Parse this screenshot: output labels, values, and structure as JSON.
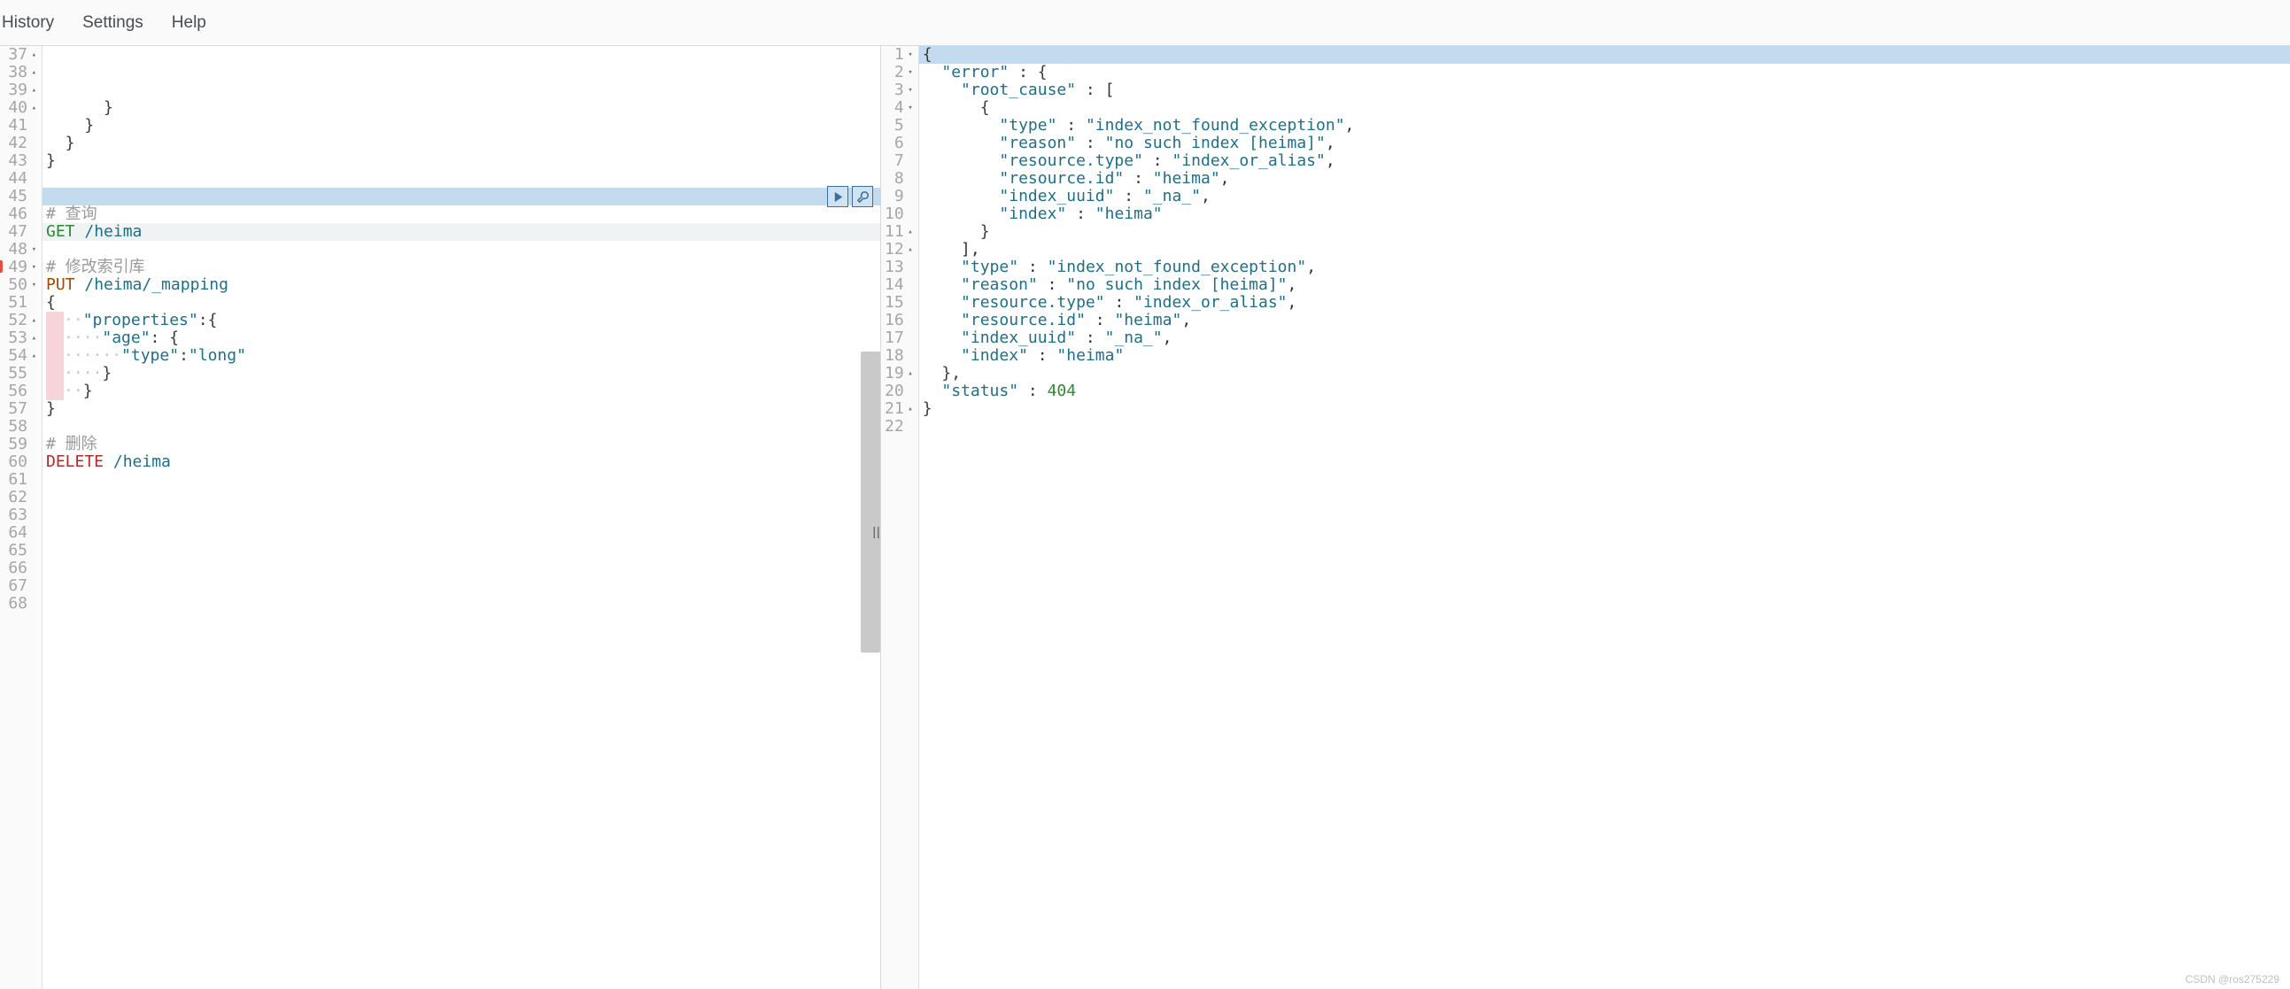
{
  "menubar": {
    "history": "History",
    "settings": "Settings",
    "help": "Help"
  },
  "watermark": "CSDN @ros275229",
  "left_editor": {
    "first_line_number": 37,
    "selected_line_number": 42,
    "error_line_number": 49,
    "lines": [
      {
        "n": 37,
        "fold": "up",
        "type": "code",
        "text": "      }"
      },
      {
        "n": 38,
        "fold": "up",
        "type": "code",
        "text": "    }"
      },
      {
        "n": 39,
        "fold": "up",
        "type": "code",
        "text": "  }"
      },
      {
        "n": 40,
        "fold": "up",
        "type": "code",
        "text": "}"
      },
      {
        "n": 41,
        "type": "blank"
      },
      {
        "n": 42,
        "type": "selected_blank"
      },
      {
        "n": 43,
        "type": "comment",
        "text": "# 查询"
      },
      {
        "n": 44,
        "type": "request",
        "method": "GET",
        "path": "/heima",
        "method_cls": "tk-method-get"
      },
      {
        "n": 45,
        "type": "blank"
      },
      {
        "n": 46,
        "type": "comment",
        "text": "# 修改索引库"
      },
      {
        "n": 47,
        "type": "request",
        "method": "PUT",
        "path": "/heima/_mapping",
        "method_cls": "tk-method-put"
      },
      {
        "n": 48,
        "fold": "down",
        "type": "code",
        "text": "{"
      },
      {
        "n": 49,
        "fold": "down",
        "type": "errcode",
        "indent": 1,
        "text_before": "\"properties\"",
        "text_after": ":{"
      },
      {
        "n": 50,
        "fold": "down",
        "type": "errcode",
        "indent": 2,
        "text_before": "\"age\"",
        "text_after": ": {"
      },
      {
        "n": 51,
        "type": "errcode",
        "indent": 3,
        "kv_key": "\"type\"",
        "kv_val": "\"long\""
      },
      {
        "n": 52,
        "fold": "up",
        "type": "errcode",
        "indent": 2,
        "plain": "}"
      },
      {
        "n": 53,
        "fold": "up",
        "type": "errcode",
        "indent": 1,
        "plain": "}"
      },
      {
        "n": 54,
        "fold": "up",
        "type": "code",
        "text": "}"
      },
      {
        "n": 55,
        "type": "blank"
      },
      {
        "n": 56,
        "type": "comment",
        "text": "# 删除"
      },
      {
        "n": 57,
        "type": "request",
        "method": "DELETE",
        "path": "/heima",
        "method_cls": "tk-method-del"
      },
      {
        "n": 58,
        "type": "blank"
      },
      {
        "n": 59,
        "type": "blank"
      },
      {
        "n": 60,
        "type": "blank"
      },
      {
        "n": 61,
        "type": "blank"
      },
      {
        "n": 62,
        "type": "blank"
      },
      {
        "n": 63,
        "type": "blank"
      },
      {
        "n": 64,
        "type": "blank"
      },
      {
        "n": 65,
        "type": "blank"
      },
      {
        "n": 66,
        "type": "blank"
      },
      {
        "n": 67,
        "type": "blank"
      },
      {
        "n": 68,
        "type": "blank"
      }
    ]
  },
  "right_viewer": {
    "lines": [
      {
        "n": 1,
        "fold": "down",
        "tokens": [
          {
            "t": "{",
            "c": "tk-brace"
          }
        ]
      },
      {
        "n": 2,
        "fold": "down",
        "tokens": [
          {
            "t": "  "
          },
          {
            "t": "\"error\"",
            "c": "tk-key"
          },
          {
            "t": " : "
          },
          {
            "t": "{",
            "c": "tk-brace"
          }
        ]
      },
      {
        "n": 3,
        "fold": "down",
        "tokens": [
          {
            "t": "    "
          },
          {
            "t": "\"root_cause\"",
            "c": "tk-key"
          },
          {
            "t": " : ["
          }
        ]
      },
      {
        "n": 4,
        "fold": "down",
        "tokens": [
          {
            "t": "      "
          },
          {
            "t": "{",
            "c": "tk-brace"
          }
        ]
      },
      {
        "n": 5,
        "tokens": [
          {
            "t": "        "
          },
          {
            "t": "\"type\"",
            "c": "tk-key"
          },
          {
            "t": " : "
          },
          {
            "t": "\"index_not_found_exception\"",
            "c": "tk-str"
          },
          {
            "t": ","
          }
        ]
      },
      {
        "n": 6,
        "tokens": [
          {
            "t": "        "
          },
          {
            "t": "\"reason\"",
            "c": "tk-key"
          },
          {
            "t": " : "
          },
          {
            "t": "\"no such index [heima]\"",
            "c": "tk-str"
          },
          {
            "t": ","
          }
        ]
      },
      {
        "n": 7,
        "tokens": [
          {
            "t": "        "
          },
          {
            "t": "\"resource.type\"",
            "c": "tk-key"
          },
          {
            "t": " : "
          },
          {
            "t": "\"index_or_alias\"",
            "c": "tk-str"
          },
          {
            "t": ","
          }
        ]
      },
      {
        "n": 8,
        "tokens": [
          {
            "t": "        "
          },
          {
            "t": "\"resource.id\"",
            "c": "tk-key"
          },
          {
            "t": " : "
          },
          {
            "t": "\"heima\"",
            "c": "tk-str"
          },
          {
            "t": ","
          }
        ]
      },
      {
        "n": 9,
        "tokens": [
          {
            "t": "        "
          },
          {
            "t": "\"index_uuid\"",
            "c": "tk-key"
          },
          {
            "t": " : "
          },
          {
            "t": "\"_na_\"",
            "c": "tk-str"
          },
          {
            "t": ","
          }
        ]
      },
      {
        "n": 10,
        "tokens": [
          {
            "t": "        "
          },
          {
            "t": "\"index\"",
            "c": "tk-key"
          },
          {
            "t": " : "
          },
          {
            "t": "\"heima\"",
            "c": "tk-str"
          }
        ]
      },
      {
        "n": 11,
        "fold": "up",
        "tokens": [
          {
            "t": "      "
          },
          {
            "t": "}",
            "c": "tk-brace"
          }
        ]
      },
      {
        "n": 12,
        "fold": "up",
        "tokens": [
          {
            "t": "    ],"
          }
        ]
      },
      {
        "n": 13,
        "tokens": [
          {
            "t": "    "
          },
          {
            "t": "\"type\"",
            "c": "tk-key"
          },
          {
            "t": " : "
          },
          {
            "t": "\"index_not_found_exception\"",
            "c": "tk-str"
          },
          {
            "t": ","
          }
        ]
      },
      {
        "n": 14,
        "tokens": [
          {
            "t": "    "
          },
          {
            "t": "\"reason\"",
            "c": "tk-key"
          },
          {
            "t": " : "
          },
          {
            "t": "\"no such index [heima]\"",
            "c": "tk-str"
          },
          {
            "t": ","
          }
        ]
      },
      {
        "n": 15,
        "tokens": [
          {
            "t": "    "
          },
          {
            "t": "\"resource.type\"",
            "c": "tk-key"
          },
          {
            "t": " : "
          },
          {
            "t": "\"index_or_alias\"",
            "c": "tk-str"
          },
          {
            "t": ","
          }
        ]
      },
      {
        "n": 16,
        "tokens": [
          {
            "t": "    "
          },
          {
            "t": "\"resource.id\"",
            "c": "tk-key"
          },
          {
            "t": " : "
          },
          {
            "t": "\"heima\"",
            "c": "tk-str"
          },
          {
            "t": ","
          }
        ]
      },
      {
        "n": 17,
        "tokens": [
          {
            "t": "    "
          },
          {
            "t": "\"index_uuid\"",
            "c": "tk-key"
          },
          {
            "t": " : "
          },
          {
            "t": "\"_na_\"",
            "c": "tk-str"
          },
          {
            "t": ","
          }
        ]
      },
      {
        "n": 18,
        "tokens": [
          {
            "t": "    "
          },
          {
            "t": "\"index\"",
            "c": "tk-key"
          },
          {
            "t": " : "
          },
          {
            "t": "\"heima\"",
            "c": "tk-str"
          }
        ]
      },
      {
        "n": 19,
        "fold": "up",
        "tokens": [
          {
            "t": "  "
          },
          {
            "t": "},",
            "c": "tk-brace"
          }
        ]
      },
      {
        "n": 20,
        "tokens": [
          {
            "t": "  "
          },
          {
            "t": "\"status\"",
            "c": "tk-key"
          },
          {
            "t": " : "
          },
          {
            "t": "404",
            "c": "tk-num"
          }
        ]
      },
      {
        "n": 21,
        "fold": "up",
        "tokens": [
          {
            "t": "}",
            "c": "tk-brace"
          }
        ]
      },
      {
        "n": 22,
        "tokens": [
          {
            "t": ""
          }
        ]
      }
    ]
  }
}
